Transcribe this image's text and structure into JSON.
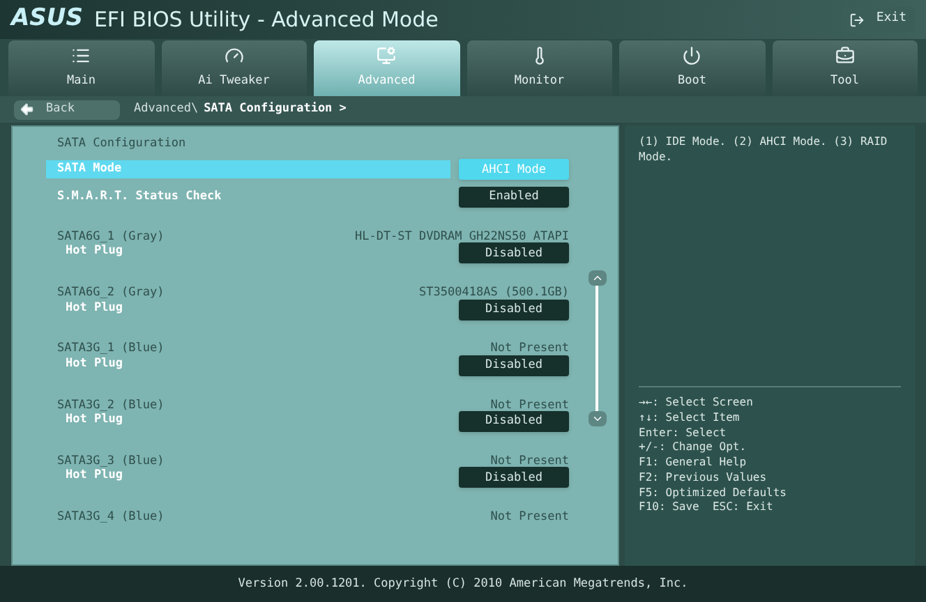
{
  "header": {
    "logo": "ASUS",
    "title": "EFI BIOS Utility - Advanced Mode",
    "exit": "Exit"
  },
  "tabs": [
    {
      "label": "Main",
      "selected": false
    },
    {
      "label": "Ai Tweaker",
      "selected": false
    },
    {
      "label": "Advanced",
      "selected": true
    },
    {
      "label": "Monitor",
      "selected": false
    },
    {
      "label": "Boot",
      "selected": false
    },
    {
      "label": "Tool",
      "selected": false
    }
  ],
  "nav": {
    "back": "Back",
    "path": "Advanced\\",
    "current": "SATA Configuration >"
  },
  "settings": {
    "title": "SATA Configuration",
    "items": [
      {
        "kind": "option",
        "label": "SATA Mode",
        "value": "AHCI Mode",
        "selected": true
      },
      {
        "kind": "option",
        "label": "S.M.A.R.T. Status Check",
        "value": "Enabled",
        "selected": false
      },
      {
        "kind": "port",
        "label": "SATA6G_1 (Gray)",
        "device": "HL-DT-ST DVDRAM GH22NS50 ATAPI",
        "sub_label": "Hot Plug",
        "sub_value": "Disabled"
      },
      {
        "kind": "port",
        "label": "SATA6G_2 (Gray)",
        "device": "ST3500418AS (500.1GB)",
        "sub_label": "Hot Plug",
        "sub_value": "Disabled"
      },
      {
        "kind": "port",
        "label": "SATA3G_1 (Blue)",
        "device": "Not Present",
        "sub_label": "Hot Plug",
        "sub_value": "Disabled"
      },
      {
        "kind": "port",
        "label": "SATA3G_2 (Blue)",
        "device": "Not Present",
        "sub_label": "Hot Plug",
        "sub_value": "Disabled"
      },
      {
        "kind": "port",
        "label": "SATA3G_3 (Blue)",
        "device": "Not Present",
        "sub_label": "Hot Plug",
        "sub_value": "Disabled"
      },
      {
        "kind": "port",
        "label": "SATA3G_4 (Blue)",
        "device": "Not Present"
      }
    ]
  },
  "help": "(1) IDE Mode. (2) AHCI Mode. (3) RAID Mode.",
  "keys": [
    "→←: Select Screen",
    "↑↓: Select Item",
    "Enter: Select",
    "+/-: Change Opt.",
    "F1: General Help",
    "F2: Previous Values",
    "F5: Optimized Defaults",
    "F10: Save  ESC: Exit"
  ],
  "footer": "Version 2.00.1201. Copyright (C) 2010 American Megatrends, Inc."
}
